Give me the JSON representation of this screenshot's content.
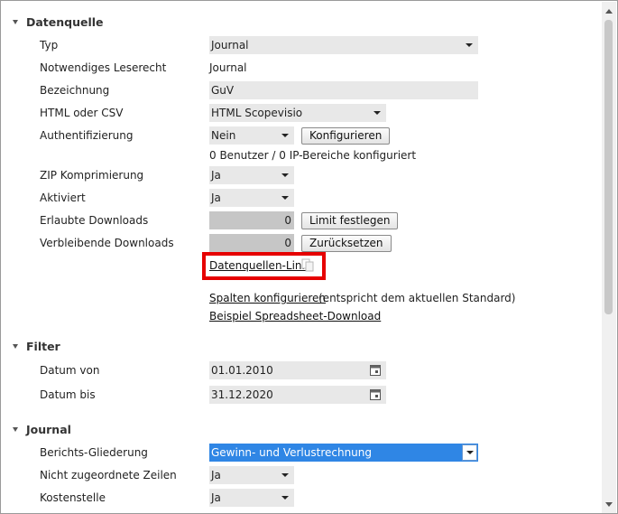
{
  "sections": {
    "datenquelle": "Datenquelle",
    "filter": "Filter",
    "journal": "Journal"
  },
  "datenquelle": {
    "typ_label": "Typ",
    "typ_value": "Journal",
    "leserecht_label": "Notwendiges Leserecht",
    "leserecht_value": "Journal",
    "bezeichnung_label": "Bezeichnung",
    "bezeichnung_value": "GuV",
    "format_label": "HTML oder CSV",
    "format_value": "HTML Scopevisio",
    "auth_label": "Authentifizierung",
    "auth_value": "Nein",
    "auth_button": "Konfigurieren",
    "auth_info": "0 Benutzer / 0 IP-Bereiche konfiguriert",
    "zip_label": "ZIP Komprimierung",
    "zip_value": "Ja",
    "aktiviert_label": "Aktiviert",
    "aktiviert_value": "Ja",
    "erlaubte_label": "Erlaubte Downloads",
    "erlaubte_value": "0",
    "limit_button": "Limit festlegen",
    "verbleibende_label": "Verbleibende Downloads",
    "verbleibende_value": "0",
    "reset_button": "Zurücksetzen",
    "datenquellen_link": "Datenquellen-Link",
    "spalten_link": "Spalten konfigurieren",
    "spalten_note": "(entspricht dem aktuellen Standard)",
    "beispiel_link": "Beispiel Spreadsheet-Download"
  },
  "filter": {
    "von_label": "Datum von",
    "von_value": "01.01.2010",
    "bis_label": "Datum bis",
    "bis_value": "31.12.2020"
  },
  "journal": {
    "gliederung_label": "Berichts-Gliederung",
    "gliederung_value": "Gewinn- und Verlustrechnung",
    "nicht_label": "Nicht zugeordnete Zeilen",
    "nicht_value": "Ja",
    "kosten_label": "Kostenstelle",
    "kosten_value": "Ja"
  },
  "colors": {
    "highlight": "#e60000",
    "selected_select": "#2f86e5",
    "field_bg": "#e8e8e8"
  }
}
